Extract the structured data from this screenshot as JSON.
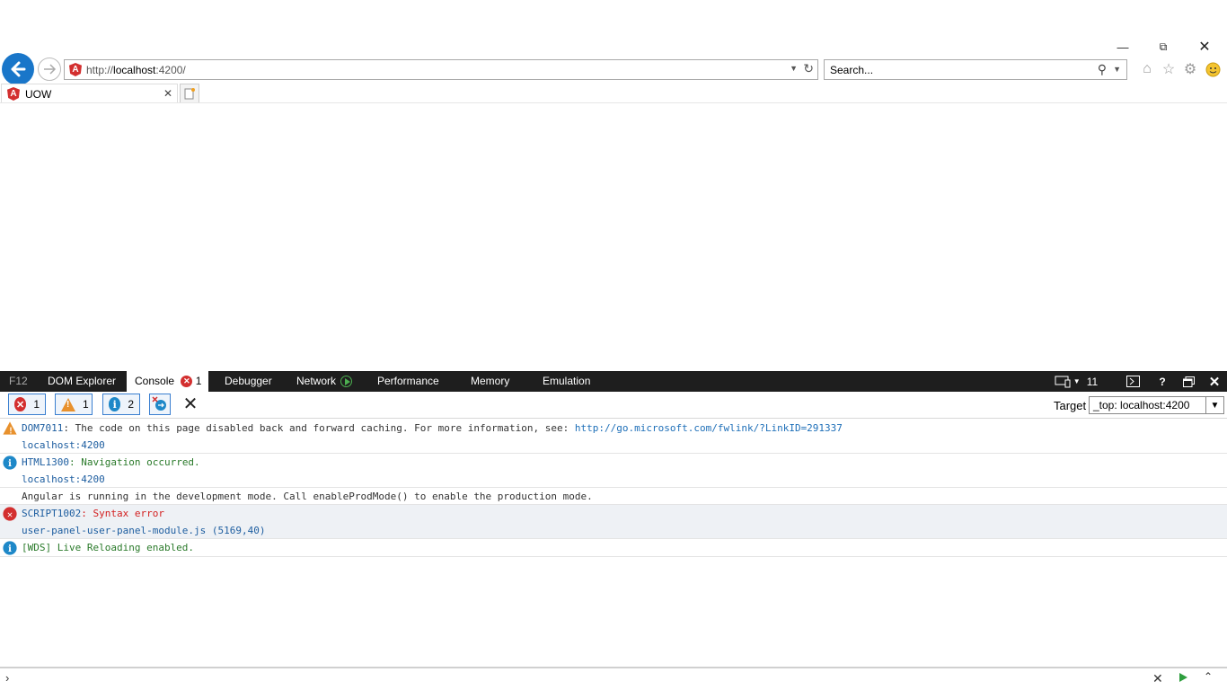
{
  "browser": {
    "address": {
      "prefix": "http://",
      "host": "localhost",
      "rest": ":4200/"
    },
    "search_placeholder": "Search...",
    "tab_title": "UOW"
  },
  "devtools": {
    "tabs": [
      {
        "label": "F12"
      },
      {
        "label": "DOM Explorer"
      },
      {
        "label": "Console",
        "badge": "1"
      },
      {
        "label": "Debugger"
      },
      {
        "label": "Network"
      },
      {
        "label": "Performance"
      },
      {
        "label": "Memory"
      },
      {
        "label": "Emulation"
      }
    ],
    "doc_mode": "11",
    "help": "?",
    "filters": {
      "errors": "1",
      "warnings": "1",
      "info": "2"
    },
    "target_label": "Target",
    "target_value": "_top: localhost:4200"
  },
  "console": [
    {
      "code": "DOM7011",
      "text": ": The code on this page disabled back and forward caching. For more information, see: ",
      "link": "http://go.microsoft.com/fwlink/?LinkID=291337",
      "source": "localhost:4200"
    },
    {
      "code": "HTML1300",
      "text": ": Navigation occurred.",
      "source": "localhost:4200"
    },
    {
      "text": "Angular is running in the development mode. Call enableProdMode() to enable the production mode."
    },
    {
      "code": "SCRIPT1002",
      "text": ": Syntax error",
      "source": "user-panel-user-panel-module.js (5169,40)"
    },
    {
      "text": "[WDS] Live Reloading enabled."
    }
  ],
  "colors": {
    "accent": "#1976c9",
    "error": "#d32f2f",
    "warning": "#e8912d",
    "info": "#1e88c8",
    "devtools_bar": "#1e1e1e"
  }
}
